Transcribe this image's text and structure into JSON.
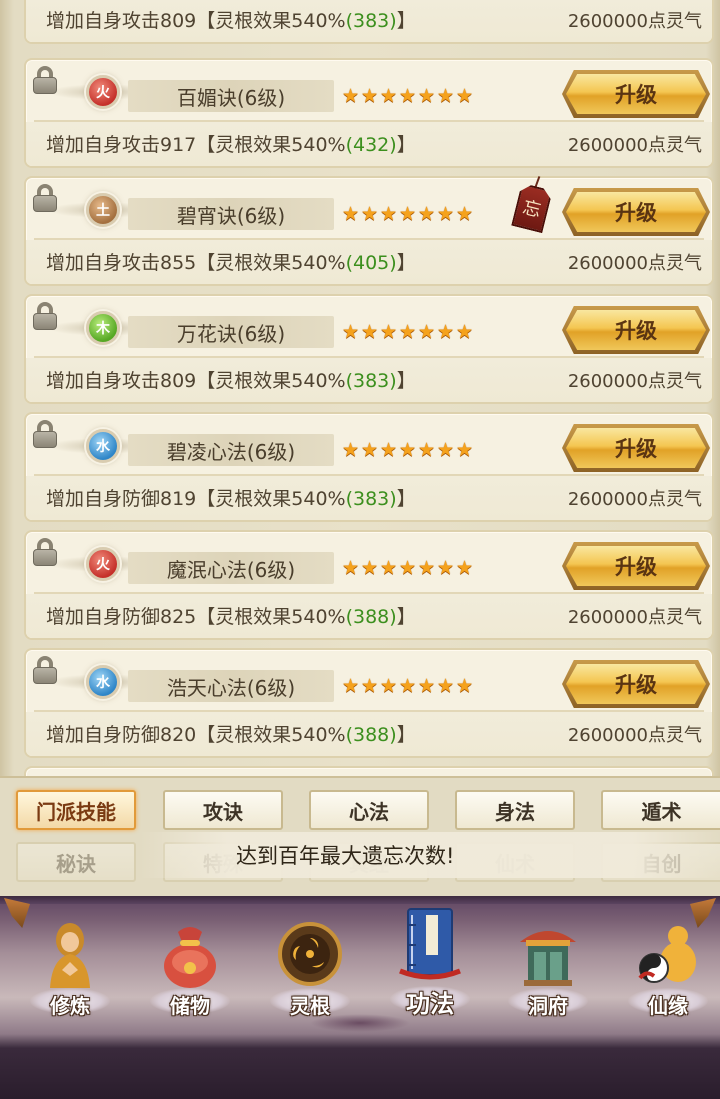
{
  "skills": [
    {
      "element": "",
      "name": "",
      "desc": "增加自身攻击809【灵根效果540%",
      "bonus": "(383)",
      "close": "】",
      "cost": "2600000点灵气",
      "upgrade": ""
    },
    {
      "element": "火",
      "elementType": "fire",
      "name": "百媚诀(6级)",
      "desc": "增加自身攻击917【灵根效果540%",
      "bonus": "(432)",
      "close": "】",
      "cost": "2600000点灵气",
      "upgrade": "升级"
    },
    {
      "element": "土",
      "elementType": "earth",
      "name": "碧宵诀(6级)",
      "desc": "增加自身攻击855【灵根效果540%",
      "bonus": "(405)",
      "close": "】",
      "cost": "2600000点灵气",
      "upgrade": "升级",
      "forget": "忘"
    },
    {
      "element": "木",
      "elementType": "wood",
      "name": "万花诀(6级)",
      "desc": "增加自身攻击809【灵根效果540%",
      "bonus": "(383)",
      "close": "】",
      "cost": "2600000点灵气",
      "upgrade": "升级"
    },
    {
      "element": "水",
      "elementType": "water",
      "name": "碧凌心法(6级)",
      "desc": "增加自身防御819【灵根效果540%",
      "bonus": "(383)",
      "close": "】",
      "cost": "2600000点灵气",
      "upgrade": "升级"
    },
    {
      "element": "火",
      "elementType": "fire",
      "name": "魔泯心法(6级)",
      "desc": "增加自身防御825【灵根效果540%",
      "bonus": "(388)",
      "close": "】",
      "cost": "2600000点灵气",
      "upgrade": "升级"
    },
    {
      "element": "水",
      "elementType": "water",
      "name": "浩天心法(6级)",
      "desc": "增加自身防御820【灵根效果540%",
      "bonus": "(388)",
      "close": "】",
      "cost": "2600000点灵气",
      "upgrade": "升级"
    }
  ],
  "star_count": 7,
  "tabs_row1": [
    "门派技能",
    "攻诀",
    "心法",
    "身法",
    "遁术"
  ],
  "tabs_row2": [
    "秘诀",
    "特殊",
    "真经",
    "仙术",
    "自创"
  ],
  "toast": "达到百年最大遗忘次数!",
  "nav": [
    "修炼",
    "储物",
    "灵根",
    "功法",
    "洞府",
    "仙缘"
  ],
  "colors": {
    "accent_gold": "#f4c651",
    "bonus_green": "#3c8f1e",
    "star": "#f5a21c"
  }
}
